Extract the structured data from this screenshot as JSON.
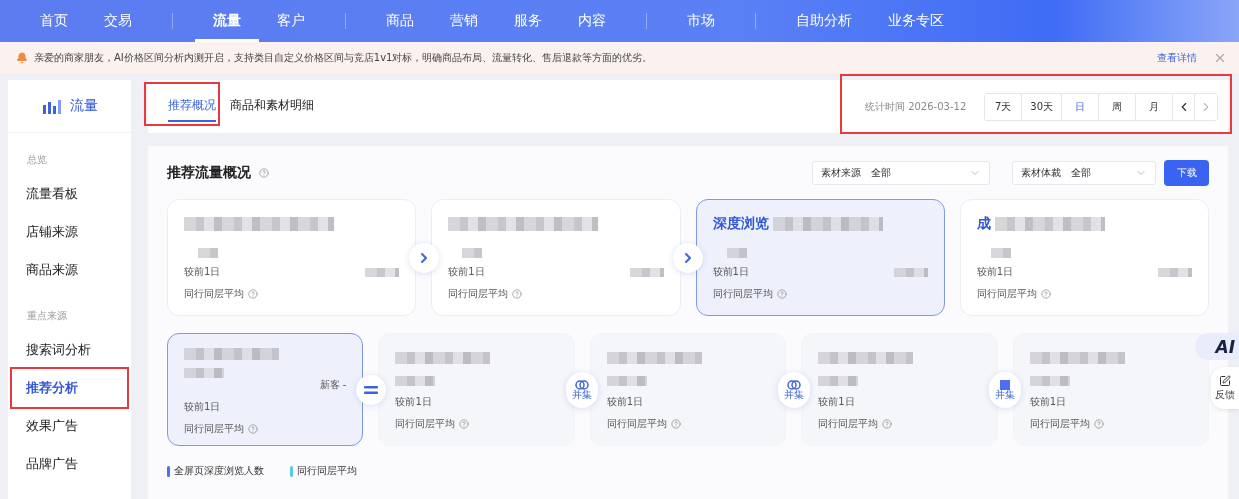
{
  "nav_groups": [
    [
      {
        "label": "首页",
        "selected": false
      },
      {
        "label": "交易",
        "selected": false
      }
    ],
    [
      {
        "label": "流量",
        "selected": true
      },
      {
        "label": "客户",
        "selected": false
      }
    ],
    [
      {
        "label": "商品",
        "selected": false
      },
      {
        "label": "营销",
        "selected": false
      },
      {
        "label": "服务",
        "selected": false
      },
      {
        "label": "内容",
        "selected": false
      }
    ],
    [
      {
        "label": "市场",
        "selected": false
      }
    ],
    [
      {
        "label": "自助分析",
        "selected": false
      },
      {
        "label": "业务专区",
        "selected": false
      }
    ]
  ],
  "notice": {
    "text": "亲爱的商家朋友，AI价格区间分析内测开启，支持类目自定义价格区间与竞店1v1对标，明确商品布局、流量转化、售后退款等方面的优劣。",
    "link": "查看详情"
  },
  "sidebar": {
    "title": "流量",
    "sections": [
      {
        "label": "总览",
        "items": [
          {
            "label": "流量看板",
            "selected": false,
            "marked": false
          },
          {
            "label": "店铺来源",
            "selected": false,
            "marked": false
          },
          {
            "label": "商品来源",
            "selected": false,
            "marked": false
          }
        ]
      },
      {
        "label": "重点来源",
        "items": [
          {
            "label": "搜索词分析",
            "selected": false,
            "marked": false
          },
          {
            "label": "推荐分析",
            "selected": true,
            "marked": true
          },
          {
            "label": "效果广告",
            "selected": false,
            "marked": false
          },
          {
            "label": "品牌广告",
            "selected": false,
            "marked": false
          }
        ]
      }
    ]
  },
  "tabs": {
    "marked": true,
    "items": [
      {
        "label": "推荐概况",
        "selected": true
      },
      {
        "label": "商品和素材明细",
        "selected": false
      }
    ]
  },
  "date_bar": {
    "marked": true,
    "label": "统计时间",
    "date": "2026-03-12",
    "periods": [
      {
        "label": "7天",
        "selected": false
      },
      {
        "label": "30天",
        "selected": false
      },
      {
        "label": "日",
        "selected": true
      },
      {
        "label": "周",
        "selected": false
      },
      {
        "label": "月",
        "selected": false
      }
    ],
    "prev_disabled": false,
    "next_disabled": true
  },
  "overview": {
    "title": "推荐流量概况",
    "filters": [
      {
        "label": "素材来源",
        "value": "全部"
      },
      {
        "label": "素材体裁",
        "value": "全部"
      }
    ],
    "download": "下载",
    "top_cards": [
      {
        "highlighted": false,
        "compare": "较前1日",
        "peer": "同行同层平均"
      },
      {
        "highlighted": false,
        "compare": "较前1日",
        "peer": "同行同层平均"
      },
      {
        "title": "深度浏览",
        "highlighted": true,
        "compare": "较前1日",
        "peer": "同行同层平均"
      },
      {
        "title": "成",
        "highlighted": false,
        "compare": "较前1日",
        "peer": "同行同层平均"
      }
    ],
    "top_connectors": [
      {
        "kind": "arrow"
      },
      {
        "kind": "arrow"
      },
      {
        "kind": "none"
      }
    ],
    "bottom_cards": [
      {
        "note": "新客 -",
        "highlighted": true,
        "compare": "较前1日",
        "peer": "同行同层平均"
      },
      {
        "highlighted": false,
        "compare": "较前1日",
        "peer": "同行同层平均"
      },
      {
        "highlighted": false,
        "compare": "较前1日",
        "peer": "同行同层平均"
      },
      {
        "highlighted": false,
        "compare": "较前1日",
        "peer": "同行同层平均"
      },
      {
        "highlighted": false,
        "compare": "较前1日",
        "peer": "同行同层平均"
      }
    ],
    "bottom_connectors": [
      {
        "kind": "equals"
      },
      {
        "kind": "union",
        "label": "并集"
      },
      {
        "kind": "union",
        "label": "并集"
      },
      {
        "kind": "union-square",
        "label": "并集"
      }
    ],
    "legend": [
      {
        "label": "全屏页深度浏览人数",
        "color": "#4e6ef2"
      },
      {
        "label": "同行同层平均",
        "color": "#5bc8f0"
      }
    ]
  },
  "float": {
    "ai": "AI",
    "feedback": "反馈"
  }
}
